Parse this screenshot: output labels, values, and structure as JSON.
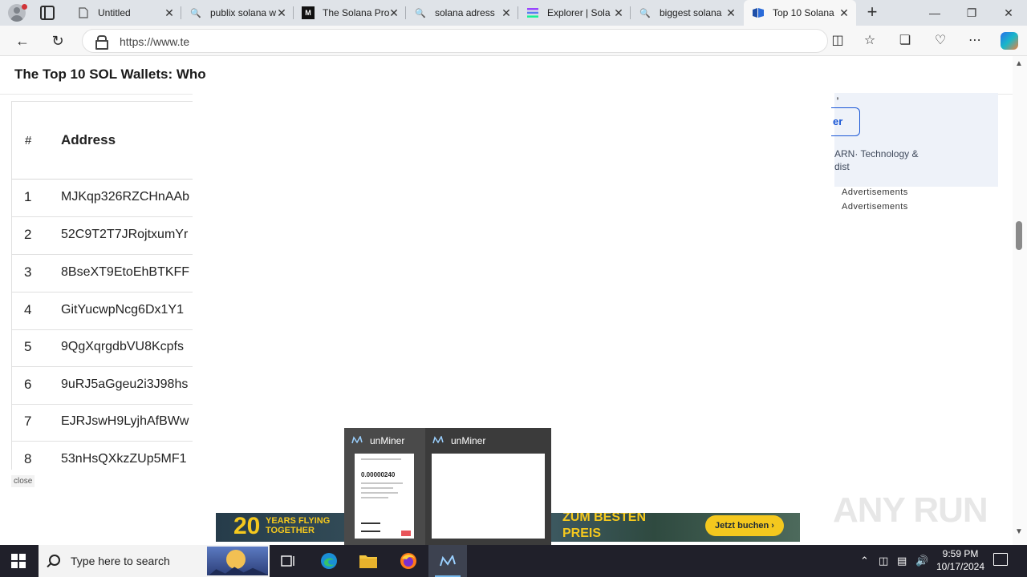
{
  "browser": {
    "tabs": [
      {
        "title": "Untitled",
        "icon": "page-icon"
      },
      {
        "title": "publix solana w",
        "icon": "search-icon"
      },
      {
        "title": "The Solana Pro",
        "icon": "medium-icon"
      },
      {
        "title": "solana adress",
        "icon": "search-icon"
      },
      {
        "title": "Explorer | Sola",
        "icon": "solana-icon"
      },
      {
        "title": "biggest solana",
        "icon": "search-icon"
      },
      {
        "title": "Top 10 Solana",
        "icon": "site-icon",
        "active": true
      }
    ],
    "url": "https://www.te"
  },
  "page": {
    "title": "The Top 10 SOL Wallets: Who",
    "table": {
      "headers": [
        "#",
        "Address"
      ],
      "rows": [
        {
          "n": "1",
          "address": "MJKqp326RZCHnAAb"
        },
        {
          "n": "2",
          "address": "52C9T2T7JRojtxumYr"
        },
        {
          "n": "3",
          "address": "8BseXT9EtoEhBTKFF"
        },
        {
          "n": "4",
          "address": "GitYucwpNcg6Dx1Y1"
        },
        {
          "n": "5",
          "address": "9QgXqrgdbVU8Kcpfs"
        },
        {
          "n": "6",
          "address": "9uRJ5aGgeu2i3J98hs"
        },
        {
          "n": "7",
          "address": "EJRJswH9LyjhAfBWw"
        },
        {
          "n": "8",
          "address": "53nHsQXkzZUp5MF1"
        }
      ]
    },
    "close_label": "close",
    "right_ad": {
      "button_text": "er",
      "text_line1": "ARN· Technology &",
      "text_line2": "dist",
      "comma": ","
    },
    "advertisements": [
      "Advertisements",
      "Advertisements"
    ]
  },
  "banner": {
    "number": "20",
    "line1": "YEARS FLYING",
    "line2": "TOGETHER",
    "big_line1": "ZUM BESTEN",
    "big_line2": "PREIS",
    "cta": "Jetzt buchen ›"
  },
  "watermark": "ANY RUN",
  "thumbnails": [
    {
      "title": "unMiner",
      "preview_value": "0.00000240"
    },
    {
      "title": "unMiner"
    }
  ],
  "taskbar": {
    "search_placeholder": "Type here to search",
    "time": "9:59 PM",
    "date": "10/17/2024"
  }
}
